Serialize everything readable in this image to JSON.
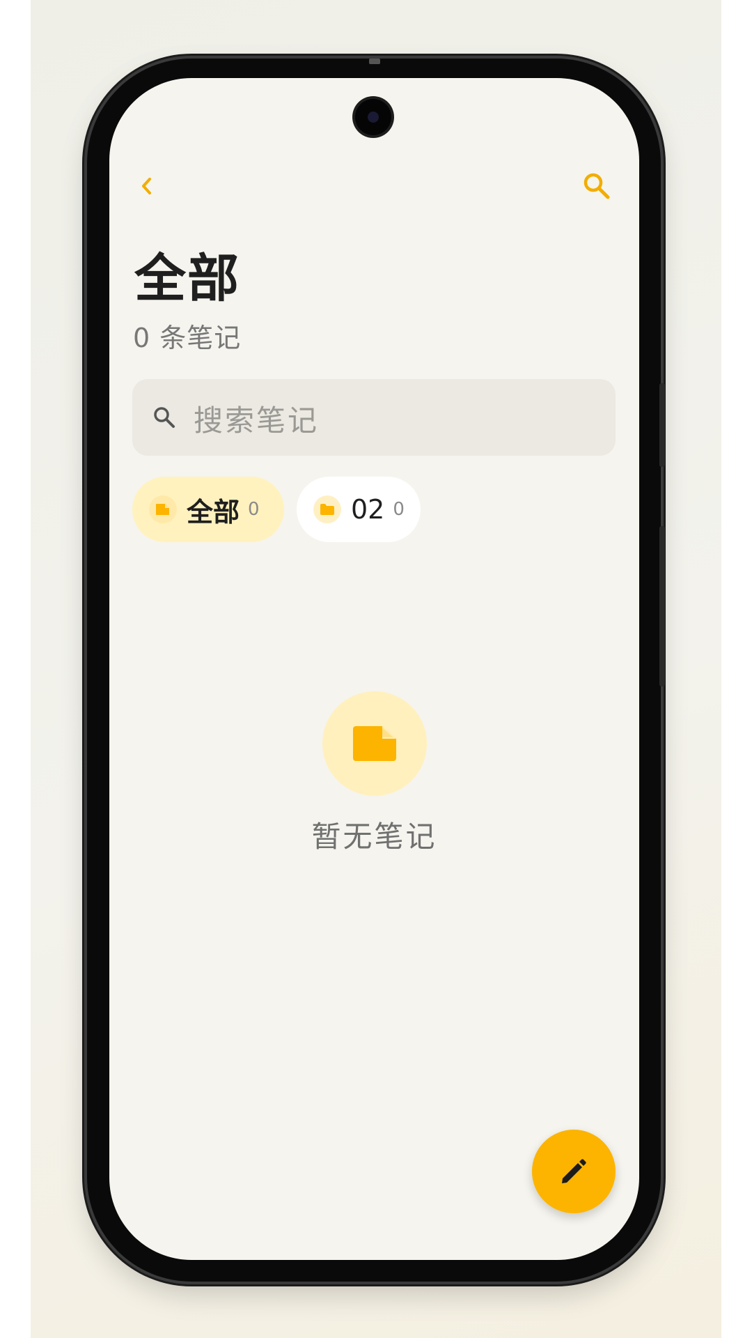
{
  "header": {
    "back_icon": "chevron-left-icon",
    "search_icon": "search-icon",
    "accent_color": "#fcb400"
  },
  "page": {
    "title": "全部",
    "count_number": "0",
    "count_suffix": "条笔记"
  },
  "search": {
    "placeholder": "搜索笔记"
  },
  "chips": [
    {
      "label": "全部",
      "count": "0",
      "icon": "note-icon",
      "selected": true
    },
    {
      "label": "02",
      "count": "0",
      "icon": "folder-icon",
      "selected": false
    }
  ],
  "empty_state": {
    "icon": "note-icon",
    "text": "暂无笔记"
  },
  "fab": {
    "icon": "edit-pencil-icon"
  }
}
